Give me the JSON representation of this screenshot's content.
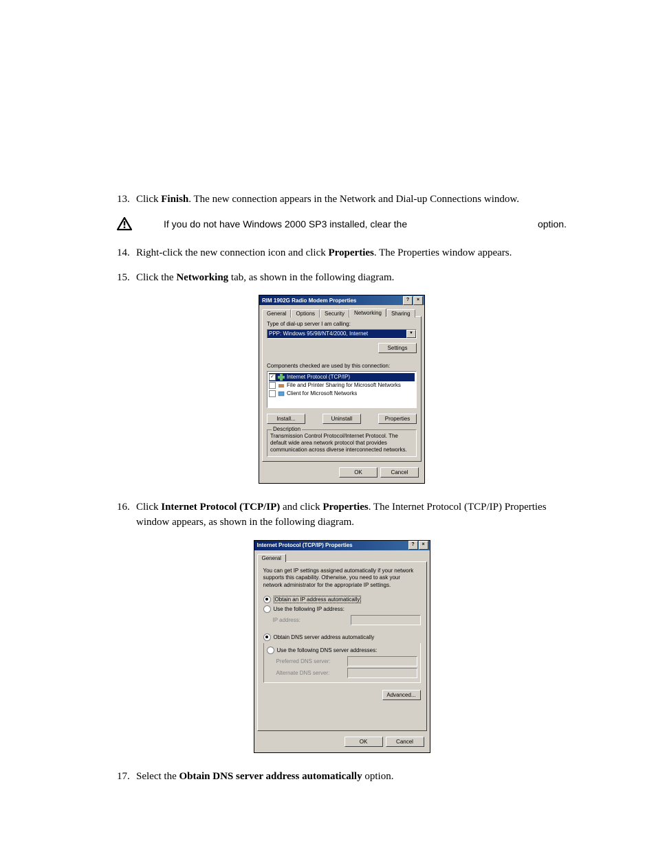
{
  "steps": {
    "s13": {
      "num": "13.",
      "pre": "Click ",
      "b1": "Finish",
      "post": ". The new connection appears in the Network and Dial-up Connections window."
    },
    "s14": {
      "num": "14.",
      "pre": "Right-click the new connection icon and click ",
      "b1": "Properties",
      "post": ". The Properties window appears."
    },
    "s15": {
      "num": "15.",
      "pre": "Click the ",
      "b1": "Networking",
      "post": " tab, as shown in the following diagram."
    },
    "s16": {
      "num": "16.",
      "pre": "Click ",
      "b1": "Internet Protocol (TCP/IP)",
      "mid": " and click ",
      "b2": "Properties",
      "post": ". The Internet Protocol (TCP/IP) Properties window appears, as shown in the following diagram."
    },
    "s17": {
      "num": "17.",
      "pre": "Select the ",
      "b1": "Obtain DNS server address automatically",
      "post": " option."
    }
  },
  "note": {
    "text": "If you do not have Windows 2000 SP3 installed, clear the",
    "trail": "option."
  },
  "dlg1": {
    "title": "RIM 1902G Radio Modem Properties",
    "help": "?",
    "close": "×",
    "tabs": {
      "general": "General",
      "options": "Options",
      "security": "Security",
      "networking": "Networking",
      "sharing": "Sharing"
    },
    "type_label": "Type of dial-up server I am calling:",
    "type_value": "PPP: Windows 95/98/NT4/2000, Internet",
    "settings": "Settings",
    "comp_label": "Components checked are used by this connection:",
    "items": {
      "tcpip": "Internet Protocol (TCP/IP)",
      "fps": "File and Printer Sharing for Microsoft Networks",
      "client": "Client for Microsoft Networks"
    },
    "install": "Install...",
    "uninstall": "Uninstall",
    "properties": "Properties",
    "desc_legend": "Description",
    "desc_text": "Transmission Control Protocol/Internet Protocol. The default wide area network protocol that provides communication across diverse interconnected networks.",
    "ok": "OK",
    "cancel": "Cancel"
  },
  "dlg2": {
    "title": "Internet Protocol (TCP/IP) Properties",
    "help": "?",
    "close": "×",
    "tab": "General",
    "intro": "You can get IP settings assigned automatically if your network supports this capability. Otherwise, you need to ask your network administrator for the appropriate IP settings.",
    "obtain_ip": "Obtain an IP address automatically",
    "use_ip": "Use the following IP address:",
    "ip_addr": "IP address:",
    "obtain_dns": "Obtain DNS server address automatically",
    "use_dns": "Use the following DNS server addresses:",
    "pref_dns": "Preferred DNS server:",
    "alt_dns": "Alternate DNS server:",
    "advanced": "Advanced...",
    "ok": "OK",
    "cancel": "Cancel"
  }
}
